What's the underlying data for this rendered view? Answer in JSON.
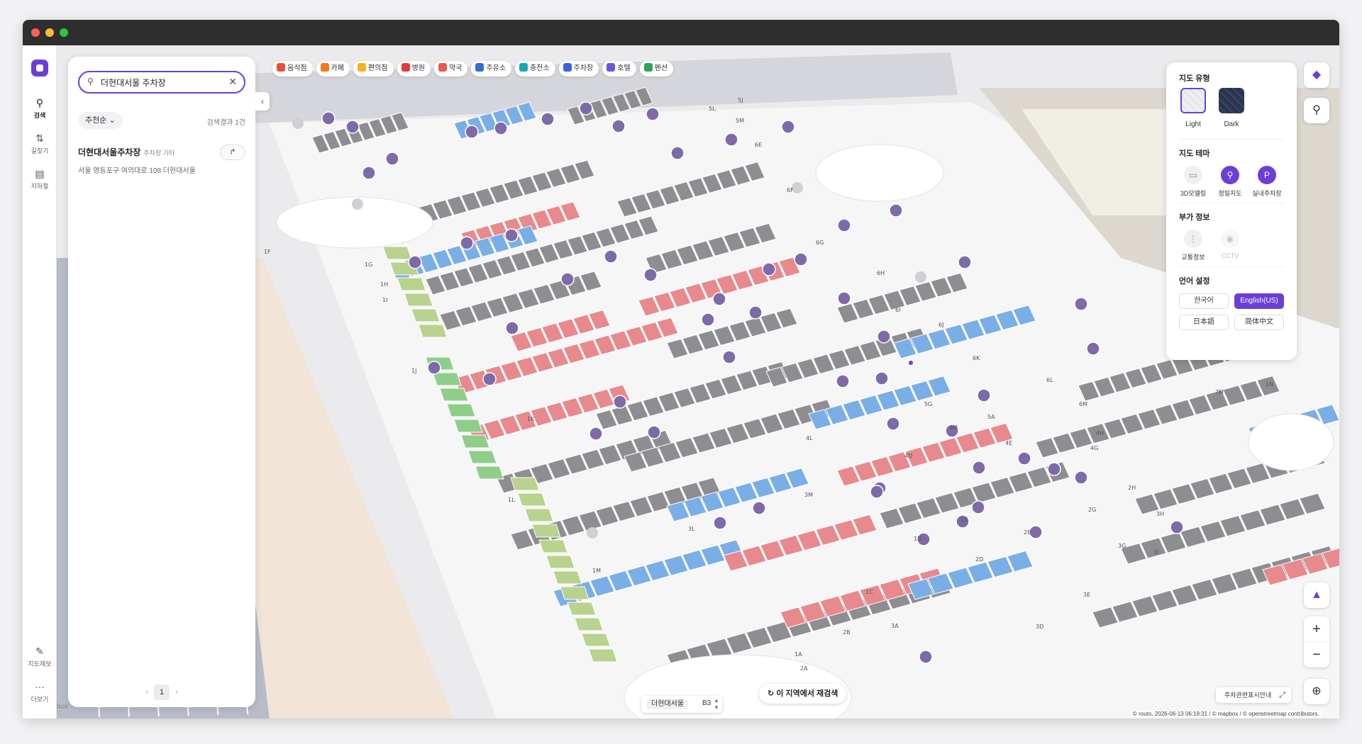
{
  "sidebar": {
    "items": [
      {
        "label": "검색",
        "icon": "search-icon"
      },
      {
        "label": "길찾기",
        "icon": "route-icon"
      },
      {
        "label": "지하철",
        "icon": "subway-icon"
      }
    ],
    "bottom": [
      {
        "label": "지도제보",
        "icon": "edit-icon"
      },
      {
        "label": "더보기",
        "icon": "more-icon"
      }
    ]
  },
  "search": {
    "value": "더현대서울 주차장",
    "sort_label": "추천순",
    "result_count": "검색결과 1건",
    "results": [
      {
        "name": "더현대서울주차장",
        "category": "주차장 기타",
        "address": "서울 영등포구 여의대로 108 더현대서울"
      }
    ],
    "page": "1"
  },
  "categories": [
    {
      "label": "음식점",
      "color": "#e8503a"
    },
    {
      "label": "카페",
      "color": "#f07a22"
    },
    {
      "label": "편의점",
      "color": "#f2b21f"
    },
    {
      "label": "병원",
      "color": "#e23b3b"
    },
    {
      "label": "약국",
      "color": "#e85a4f"
    },
    {
      "label": "주유소",
      "color": "#2f6fd8"
    },
    {
      "label": "충전소",
      "color": "#1aa6b7"
    },
    {
      "label": "주차장",
      "color": "#3e63dd"
    },
    {
      "label": "호텔",
      "color": "#6b58d6"
    },
    {
      "label": "펜션",
      "color": "#2fa35a"
    }
  ],
  "layer_panel": {
    "map_type_title": "지도 유형",
    "map_types": [
      {
        "label": "Light",
        "selected": true
      },
      {
        "label": "Dark",
        "selected": false
      }
    ],
    "theme_title": "지도 테마",
    "themes": [
      {
        "label": "3D모델링",
        "active": false
      },
      {
        "label": "정밀지도",
        "active": true
      },
      {
        "label": "실내주차장",
        "active": true
      }
    ],
    "extra_title": "부가 정보",
    "extras": [
      {
        "label": "교통정보",
        "active": false
      },
      {
        "label": "CCTV",
        "active": false
      }
    ],
    "language_title": "언어 설정",
    "languages": [
      {
        "label": "한국어",
        "active": false
      },
      {
        "label": "English(US)",
        "active": true
      },
      {
        "label": "日本語",
        "active": false
      },
      {
        "label": "简体中文",
        "active": false
      }
    ]
  },
  "map": {
    "research_label": "이 지역에서 재검색",
    "floor_name": "더현대서울",
    "floor_level": "B3",
    "legend_label": "주차관련표시안내",
    "attribution": "© routo, 2026-06-13 06:19:31 / © mapbox / © openstreetmap contributors.",
    "mapbox_text": "box",
    "accent": "#6b3fd6",
    "spot_colors": {
      "gray": "#8e8e92",
      "red": "#e8898e",
      "blue": "#7aaee6",
      "green": "#8fce8a",
      "olive": "#b9d28e"
    },
    "zone_labels": [
      "1A",
      "1C",
      "1D",
      "1E",
      "1F",
      "1G",
      "1H",
      "1I",
      "1J",
      "1K",
      "1L",
      "1M",
      "2A",
      "2B",
      "2D",
      "2E",
      "2G",
      "2H",
      "3A",
      "3D",
      "3E",
      "3G",
      "3H",
      "3I",
      "3L",
      "3M",
      "4D",
      "4E",
      "4G",
      "4H",
      "4L",
      "4M",
      "5A",
      "5G",
      "5J",
      "5L",
      "5M",
      "6E",
      "6F",
      "6G",
      "6H",
      "6I",
      "6J",
      "6K",
      "6L",
      "6M",
      "7M",
      "1N"
    ]
  }
}
